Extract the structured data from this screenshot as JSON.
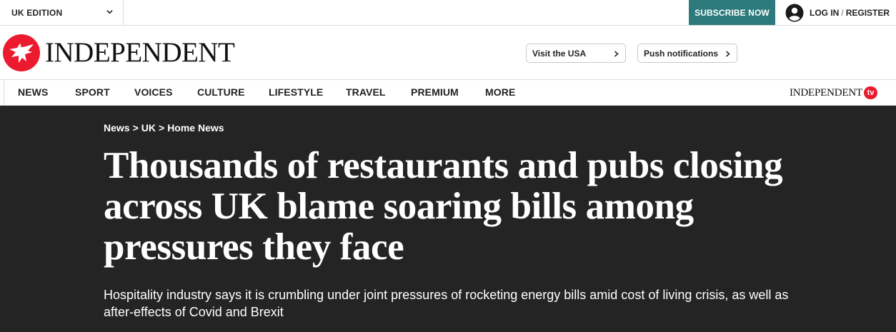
{
  "topbar": {
    "edition_label": "UK EDITION",
    "subscribe_label": "SUBSCRIBE NOW",
    "login_label": "LOG IN",
    "login_separator": "/",
    "register_label": "REGISTER"
  },
  "masthead": {
    "brand": "INDEPENDENT",
    "visit_usa_label": "Visit the USA",
    "push_label": "Push notifications"
  },
  "nav": {
    "items": [
      "NEWS",
      "SPORT",
      "VOICES",
      "CULTURE",
      "LIFESTYLE",
      "TRAVEL",
      "PREMIUM",
      "MORE"
    ],
    "tv_brand": "INDEPENDENT",
    "tv_badge": "tv"
  },
  "breadcrumb": {
    "items": [
      "News",
      "UK",
      "Home News"
    ],
    "separator": ">"
  },
  "article": {
    "headline": "Thousands of restaurants and pubs closing across UK blame soaring bills among pressures they face",
    "standfirst": "Hospitality industry says it is crumbling under joint pressures of rocketing energy bills amid cost of living crisis, as well as after-effects of Covid and Brexit"
  },
  "colors": {
    "subscribe_bg": "#2c7a7b",
    "hero_bg": "#242424",
    "brand_red": "#ec1a2e"
  }
}
